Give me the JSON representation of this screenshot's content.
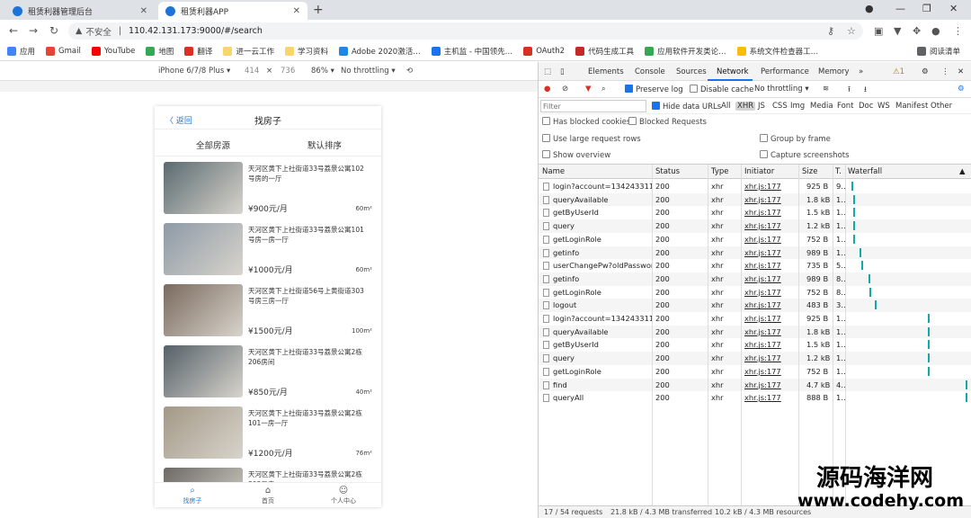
{
  "browser": {
    "tabs": [
      {
        "title": "租赁利器管理后台",
        "active": false
      },
      {
        "title": "租赁利器APP",
        "active": true
      }
    ],
    "new_tab": "+",
    "address": {
      "warning": "▲",
      "insecure": "不安全",
      "separator": "|",
      "url": "110.42.131.173:9000/#/search"
    },
    "bookmarks": [
      "应用",
      "Gmail",
      "YouTube",
      "地图",
      "翻译",
      "进一云工作",
      "学习资料",
      "Adobe 2020激活…",
      "主机监 - 中国领先…",
      "OAuth2",
      "代码生成工具",
      "应用软件开发类论…",
      "系统文件检查器工…",
      "阅读清单"
    ],
    "bookmark_colors": [
      "#4285f4",
      "#ea4335",
      "#ff0000",
      "#34a853",
      "#d93025",
      "#f9d56e",
      "#f9d56e",
      "#1e88e5",
      "#1a73e8",
      "#d93025",
      "#c62828",
      "#34a853",
      "#fbbc05",
      "#5f6368"
    ]
  },
  "device_toolbar": {
    "device": "iPhone 6/7/8 Plus ▾",
    "width": "414",
    "x": "×",
    "height": "736",
    "zoom": "86% ▾",
    "throttle": "No throttling ▾"
  },
  "app": {
    "back": "〈 返回",
    "title": "找房子",
    "filters": [
      "全部房源",
      "默认排序"
    ],
    "listings": [
      {
        "title": "天河区黄下上社街道33号荔景公寓102号房的一厅",
        "price": "¥900元/月",
        "area": "60m²",
        "color": "#5a6a70"
      },
      {
        "title": "天河区黄下上社街道33号荔景公寓101号房一房一厅",
        "price": "¥1000元/月",
        "area": "60m²",
        "color": "#8d9aa6"
      },
      {
        "title": "天河区黄下上社街道56号上黄街道303号房三房一厅",
        "price": "¥1500元/月",
        "area": "100m²",
        "color": "#7a6a5e"
      },
      {
        "title": "天河区黄下上社街道33号荔景公寓2栋206房间",
        "price": "¥850元/月",
        "area": "40m²",
        "color": "#556068"
      },
      {
        "title": "天河区黄下上社街道33号荔景公寓2栋101一房一厅",
        "price": "¥1200元/月",
        "area": "76m²",
        "color": "#a39886"
      },
      {
        "title": "天河区黄下上社街道33号荔景公寓2栋303号房",
        "price": "",
        "area": "",
        "color": "#6d6a66"
      }
    ],
    "tabbar": [
      {
        "label": "找房子",
        "icon": "⌕",
        "active": true
      },
      {
        "label": "首页",
        "icon": "⌂",
        "active": false
      },
      {
        "label": "个人中心",
        "icon": "☺",
        "active": false
      }
    ]
  },
  "devtools": {
    "tabs": [
      "Elements",
      "Console",
      "Sources",
      "Network",
      "Performance",
      "Memory",
      "»"
    ],
    "active_tab": "Network",
    "warnings": "⚠1",
    "toolbar": {
      "preserve_log": "Preserve log",
      "disable_cache": "Disable cache",
      "throttle": "No throttling"
    },
    "filter": {
      "placeholder": "Filter",
      "hide_data_urls": "Hide data URLs",
      "types": [
        "All",
        "XHR",
        "JS",
        "CSS",
        "Img",
        "Media",
        "Font",
        "Doc",
        "WS",
        "Manifest",
        "Other"
      ],
      "active_type": "XHR"
    },
    "options": {
      "blocked_cookies": "Has blocked cookies",
      "blocked_requests": "Blocked Requests",
      "large_rows": "Use large request rows",
      "group_by_frame": "Group by frame",
      "show_overview": "Show overview",
      "capture_screenshots": "Capture screenshots"
    },
    "columns": [
      "Name",
      "Status",
      "Type",
      "Initiator",
      "Size",
      "T.",
      "Waterfall"
    ],
    "requests": [
      {
        "name": "login?account=134243311…",
        "status": "200",
        "type": "xhr",
        "initiator": "xhr.js:177",
        "size": "925 B",
        "time": "9…",
        "wf": 0.02
      },
      {
        "name": "queryAvailable",
        "status": "200",
        "type": "xhr",
        "initiator": "xhr.js:177",
        "size": "1.8 kB",
        "time": "1…",
        "wf": 0.04
      },
      {
        "name": "getByUserId",
        "status": "200",
        "type": "xhr",
        "initiator": "xhr.js:177",
        "size": "1.5 kB",
        "time": "1…",
        "wf": 0.04
      },
      {
        "name": "query",
        "status": "200",
        "type": "xhr",
        "initiator": "xhr.js:177",
        "size": "1.2 kB",
        "time": "1…",
        "wf": 0.04
      },
      {
        "name": "getLoginRole",
        "status": "200",
        "type": "xhr",
        "initiator": "xhr.js:177",
        "size": "752 B",
        "time": "1…",
        "wf": 0.04
      },
      {
        "name": "getinfo",
        "status": "200",
        "type": "xhr",
        "initiator": "xhr.js:177",
        "size": "989 B",
        "time": "1…",
        "wf": 0.09
      },
      {
        "name": "userChangePw?oldPasswor…",
        "status": "200",
        "type": "xhr",
        "initiator": "xhr.js:177",
        "size": "735 B",
        "time": "5…",
        "wf": 0.11
      },
      {
        "name": "getinfo",
        "status": "200",
        "type": "xhr",
        "initiator": "xhr.js:177",
        "size": "989 B",
        "time": "8…",
        "wf": 0.17
      },
      {
        "name": "getLoginRole",
        "status": "200",
        "type": "xhr",
        "initiator": "xhr.js:177",
        "size": "752 B",
        "time": "8…",
        "wf": 0.18
      },
      {
        "name": "logout",
        "status": "200",
        "type": "xhr",
        "initiator": "xhr.js:177",
        "size": "483 B",
        "time": "3…",
        "wf": 0.22
      },
      {
        "name": "login?account=134243311…",
        "status": "200",
        "type": "xhr",
        "initiator": "xhr.js:177",
        "size": "925 B",
        "time": "1…",
        "wf": 0.68
      },
      {
        "name": "queryAvailable",
        "status": "200",
        "type": "xhr",
        "initiator": "xhr.js:177",
        "size": "1.8 kB",
        "time": "1…",
        "wf": 0.68
      },
      {
        "name": "getByUserId",
        "status": "200",
        "type": "xhr",
        "initiator": "xhr.js:177",
        "size": "1.5 kB",
        "time": "1…",
        "wf": 0.68
      },
      {
        "name": "query",
        "status": "200",
        "type": "xhr",
        "initiator": "xhr.js:177",
        "size": "1.2 kB",
        "time": "1…",
        "wf": 0.68
      },
      {
        "name": "getLoginRole",
        "status": "200",
        "type": "xhr",
        "initiator": "xhr.js:177",
        "size": "752 B",
        "time": "1…",
        "wf": 0.68
      },
      {
        "name": "find",
        "status": "200",
        "type": "xhr",
        "initiator": "xhr.js:177",
        "size": "4.7 kB",
        "time": "4…",
        "wf": 1.0
      },
      {
        "name": "queryAll",
        "status": "200",
        "type": "xhr",
        "initiator": "xhr.js:177",
        "size": "888 B",
        "time": "1…",
        "wf": 1.0
      }
    ],
    "status": {
      "requests": "17 / 54 requests",
      "transferred": "21.8 kB / 4.3 MB transferred",
      "resources": "10.2 kB / 4.3 MB resources"
    }
  },
  "watermark": {
    "cn": "源码海洋网",
    "url": "www.codehy.com"
  }
}
